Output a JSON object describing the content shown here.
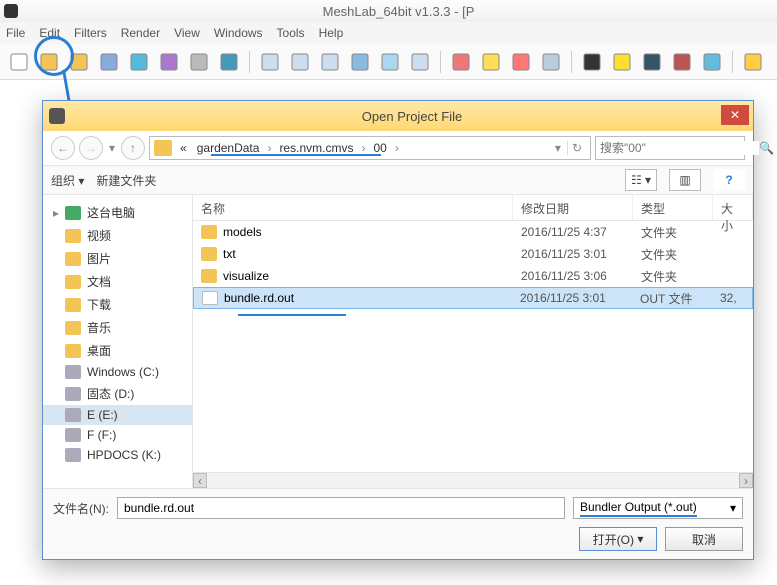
{
  "app": {
    "title": "MeshLab_64bit v1.3.3 - [P"
  },
  "menu": [
    "File",
    "Edit",
    "Filters",
    "Render",
    "View",
    "Windows",
    "Tools",
    "Help"
  ],
  "toolbar_icons": [
    "document-new",
    "folder-open",
    "project-open",
    "reload",
    "image",
    "filters",
    "layers",
    "snapshot",
    "sep",
    "box-wire",
    "points",
    "box-solid",
    "box-texture",
    "box-light",
    "box-select",
    "sep",
    "pick",
    "light",
    "material",
    "mesh",
    "sep",
    "target",
    "marker-a",
    "info",
    "plugin",
    "ruler",
    "sep",
    "mesh-info"
  ],
  "dialog": {
    "title": "Open Project File",
    "breadcrumb": {
      "prefix": "«",
      "segs": [
        "gardenData",
        "res.nvm.cmvs",
        "00"
      ]
    },
    "search_placeholder": "搜索\"00\"",
    "toolbar": {
      "organize": "组织 ▾",
      "newfolder": "新建文件夹"
    },
    "nav": {
      "root": "这台电脑",
      "items": [
        "视频",
        "图片",
        "文档",
        "下载",
        "音乐",
        "桌面",
        "Windows (C:)",
        "固态 (D:)",
        "E (E:)",
        "F (F:)",
        "HPDOCS (K:)"
      ]
    },
    "columns": {
      "name": "名称",
      "date": "修改日期",
      "type": "类型",
      "size": "大小"
    },
    "files": [
      {
        "name": "models",
        "date": "2016/11/25 4:37",
        "type": "文件夹",
        "size": "",
        "kind": "folder"
      },
      {
        "name": "txt",
        "date": "2016/11/25 3:01",
        "type": "文件夹",
        "size": "",
        "kind": "folder"
      },
      {
        "name": "visualize",
        "date": "2016/11/25 3:06",
        "type": "文件夹",
        "size": "",
        "kind": "folder"
      },
      {
        "name": "bundle.rd.out",
        "date": "2016/11/25 3:01",
        "type": "OUT 文件",
        "size": "32,",
        "kind": "file",
        "selected": true
      }
    ],
    "footer": {
      "filename_label": "文件名(N):",
      "filename_value": "bundle.rd.out",
      "filter": "Bundler Output (*.out)",
      "open": "打开(O)",
      "cancel": "取消"
    }
  }
}
